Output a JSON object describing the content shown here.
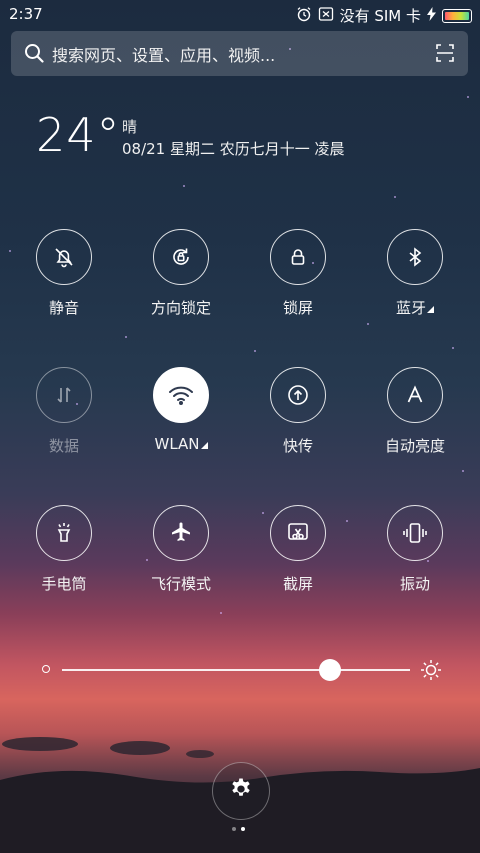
{
  "status_bar": {
    "time": "2:37",
    "sim_text": "没有 SIM 卡",
    "icons": [
      "alarm-icon",
      "no-sim-icon",
      "charging-icon",
      "battery-icon"
    ]
  },
  "search": {
    "placeholder": "搜索网页、设置、应用、视频...",
    "icons": [
      "search-icon",
      "scan-icon"
    ]
  },
  "weather": {
    "temperature": "24°",
    "condition": "晴",
    "date_line": "08/21  星期二  农历七月十一  凌晨"
  },
  "toggles": [
    {
      "label": "静音",
      "icon": "bell-off-icon",
      "state": "off"
    },
    {
      "label": "方向锁定",
      "icon": "rotation-lock-icon",
      "state": "off"
    },
    {
      "label": "锁屏",
      "icon": "lock-icon",
      "state": "off"
    },
    {
      "label": "蓝牙",
      "icon": "bluetooth-icon",
      "state": "off",
      "expandable": true
    },
    {
      "label": "数据",
      "icon": "mobile-data-icon",
      "state": "disabled"
    },
    {
      "label": "WLAN",
      "icon": "wifi-icon",
      "state": "on",
      "expandable": true
    },
    {
      "label": "快传",
      "icon": "quick-transfer-icon",
      "state": "off"
    },
    {
      "label": "自动亮度",
      "icon": "auto-brightness-icon",
      "state": "off"
    },
    {
      "label": "手电筒",
      "icon": "flashlight-icon",
      "state": "off"
    },
    {
      "label": "飞行模式",
      "icon": "airplane-icon",
      "state": "off"
    },
    {
      "label": "截屏",
      "icon": "screenshot-icon",
      "state": "off"
    },
    {
      "label": "振动",
      "icon": "vibrate-icon",
      "state": "off"
    }
  ],
  "brightness": {
    "level_fraction": 0.77
  },
  "pager": {
    "pages": 2,
    "current": 2
  },
  "colors": {
    "accent_on": "#ffffff",
    "wifi_glyph": "#2f3a4f"
  }
}
